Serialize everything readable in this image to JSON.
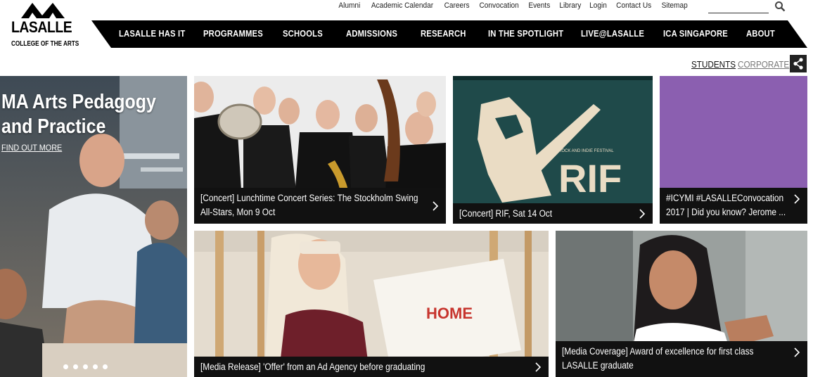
{
  "brand": {
    "name": "LASALLE",
    "subtitle": "COLLEGE OF THE ARTS"
  },
  "utility_links": [
    "Alumni",
    "Academic Calendar",
    "Careers",
    "Convocation",
    "Events",
    "Library",
    "Login",
    "Contact Us",
    "Sitemap"
  ],
  "search": {
    "placeholder": "",
    "icon": "search-icon"
  },
  "nav": [
    "LASALLE HAS IT",
    "PROGRAMMES",
    "SCHOOLS",
    "ADMISSIONS",
    "RESEARCH",
    "IN THE SPOTLIGHT",
    "LIVE@LASALLE",
    "ICA SINGAPORE",
    "ABOUT"
  ],
  "audience": {
    "students": "STUDENTS",
    "corporate": "CORPORATE"
  },
  "hero": {
    "title_line1": "MA Arts Pedagogy",
    "title_line2": "and Practice",
    "cta": "FIND OUT MORE",
    "slides": 5,
    "active_slide": 1
  },
  "tiles": [
    {
      "caption": "[Concert] Lunchtime Concert Series: The Stockholm Swing All-Stars, Mon 9 Oct"
    },
    {
      "caption": "[Concert] RIF, Sat 14 Oct",
      "poster": {
        "title": "RIF",
        "tagline": "ROCK AND INDIE FESTIVAL"
      }
    },
    {
      "caption": "#ICYMI #LASALLEConvocation 2017 | Did you know? Jerome ...",
      "color": "#8b5fb0"
    },
    {
      "caption": "[Media Release] 'Offer' from an Ad Agency before graduating",
      "artwork": "HOME"
    },
    {
      "caption": "[Media Coverage] Award of excellence for first class LASALLE graduate"
    }
  ],
  "colors": {
    "nav_bg": "#000000",
    "caption_bg": "#111111",
    "purple_tile": "#8b5fb0",
    "rif_bg": "#1f4a4a"
  }
}
